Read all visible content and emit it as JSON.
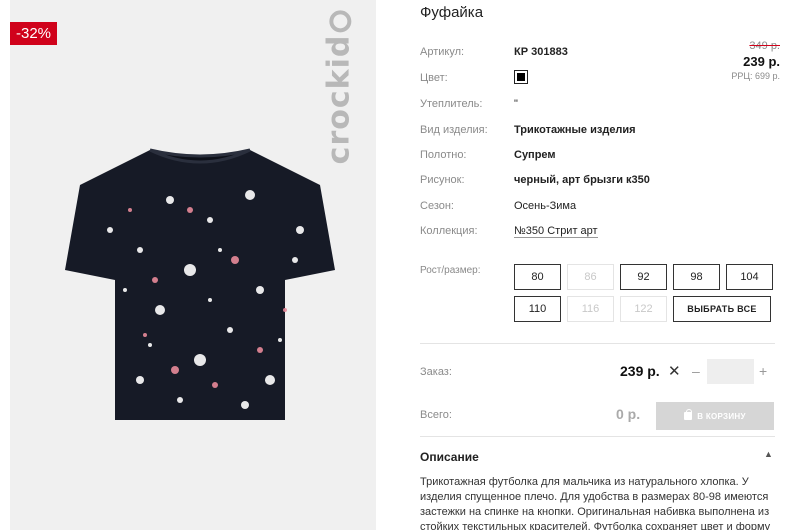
{
  "product": {
    "discount": "-32%",
    "brand": "crockid",
    "title": "Фуфайка"
  },
  "prices": {
    "old": "349 р.",
    "current": "239 р.",
    "rrc": "РРЦ: 699 р."
  },
  "attributes": {
    "article": {
      "label": "Артикул:",
      "value": "КР 301883"
    },
    "color": {
      "label": "Цвет:",
      "swatch": "#000000"
    },
    "insulation": {
      "label": "Утеплитель:",
      "value": "\""
    },
    "type": {
      "label": "Вид изделия:",
      "value": "Трикотажные изделия"
    },
    "fabric": {
      "label": "Полотно:",
      "value": "Супрем"
    },
    "pattern": {
      "label": "Рисунок:",
      "value": "черный, арт брызги к350"
    },
    "season": {
      "label": "Сезон:",
      "value": "Осень-Зима"
    },
    "collection": {
      "label": "Коллекция:",
      "value": "№350 Стрит арт"
    }
  },
  "sizes": {
    "label": "Рост/размер:",
    "items": [
      {
        "label": "80",
        "available": true
      },
      {
        "label": "86",
        "available": false
      },
      {
        "label": "92",
        "available": true
      },
      {
        "label": "98",
        "available": true
      },
      {
        "label": "104",
        "available": true
      },
      {
        "label": "110",
        "available": true
      },
      {
        "label": "116",
        "available": false
      },
      {
        "label": "122",
        "available": false
      }
    ],
    "select_all": "ВЫБРАТЬ ВСЕ"
  },
  "order": {
    "label": "Заказ:",
    "price": "239 р.",
    "times": "✕",
    "minus": "–",
    "plus": "+",
    "quantity": ""
  },
  "total": {
    "label": "Всего:",
    "value": "0 р.",
    "cart_button": "В КОРЗИНУ"
  },
  "description": {
    "heading": "Описание",
    "text": "Трикотажная футболка для мальчика из натурального хлопка. У изделия спущенное плечо. Для удобства в размерах 80-98 имеются застежки на спинке на кнопки. Оригинальная набивка выполнена из стойких текстильных красителей. Футболка сохраняет цвет и форму"
  },
  "colors": {
    "accent": "#d0021b",
    "button_disabled": "#d6d6d6"
  }
}
